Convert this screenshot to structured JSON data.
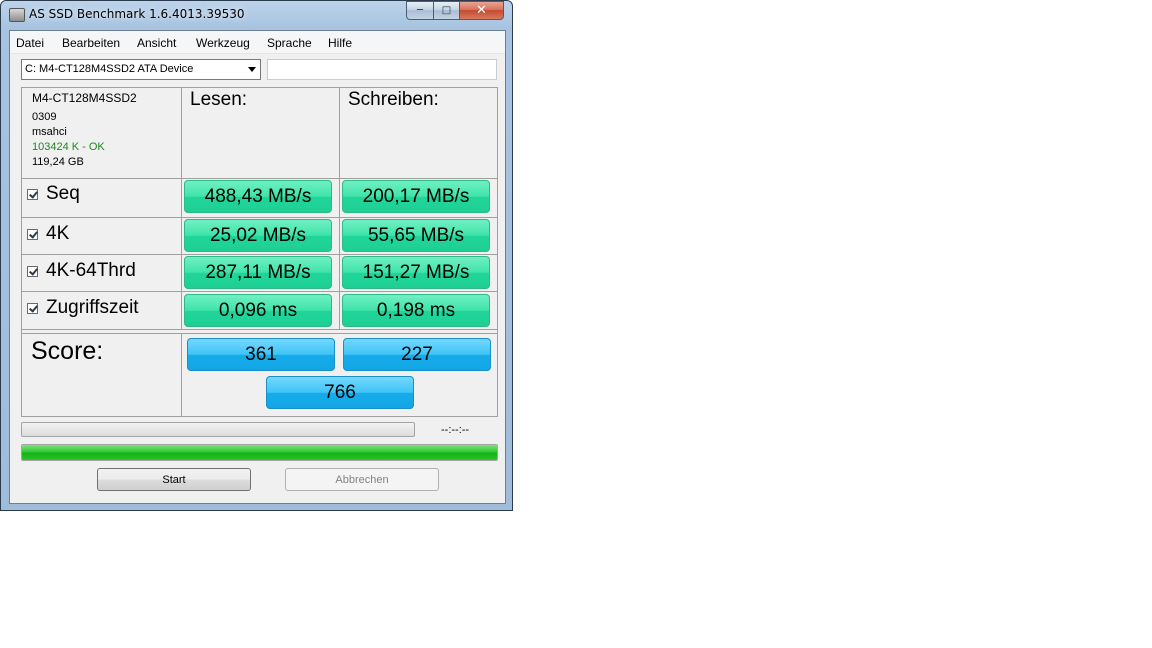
{
  "window": {
    "title": "AS SSD Benchmark 1.6.4013.39530"
  },
  "menu": [
    "Datei",
    "Bearbeiten",
    "Ansicht",
    "Werkzeug",
    "Sprache",
    "Hilfe"
  ],
  "device": {
    "selected": "C: M4-CT128M4SSD2 ATA Device"
  },
  "info": {
    "model": "M4-CT128M4SSD2",
    "firmware": "0309",
    "driver": "msahci",
    "alignment": "103424 K - OK",
    "size": "119,24 GB"
  },
  "columns": {
    "read": "Lesen:",
    "write": "Schreiben:"
  },
  "rows": [
    {
      "label": "Seq",
      "read": "488,43 MB/s",
      "write": "200,17 MB/s"
    },
    {
      "label": "4K",
      "read": "25,02 MB/s",
      "write": "55,65 MB/s"
    },
    {
      "label": "4K-64Thrd",
      "read": "287,11 MB/s",
      "write": "151,27 MB/s"
    },
    {
      "label": "Zugriffszeit",
      "read": "0,096 ms",
      "write": "0,198 ms"
    }
  ],
  "score": {
    "label": "Score:",
    "read": "361",
    "write": "227",
    "total": "766"
  },
  "progress": {
    "time": "--:--:--",
    "main_fraction": 1.0
  },
  "buttons": {
    "start": "Start",
    "cancel": "Abbrechen"
  },
  "colors": {
    "result_green": "#3fe3a9",
    "score_blue": "#3fc4f5",
    "progress_green": "#32c832"
  }
}
